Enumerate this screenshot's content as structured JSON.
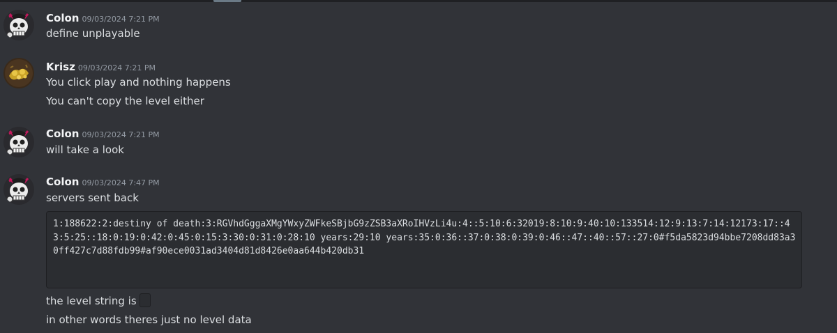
{
  "colors": {
    "background": "#313338",
    "username": "#f2f3f5",
    "timestamp": "#949ba4",
    "message_text": "#dbdee1",
    "code_background": "#2b2d31"
  },
  "messages": [
    {
      "author": "Colon",
      "avatar_icon": "skull-avatar-icon",
      "timestamp": "09/03/2024 7:21 PM",
      "lines": [
        "define unplayable"
      ]
    },
    {
      "author": "Krisz",
      "avatar_icon": "gold-coins-avatar-icon",
      "timestamp": "09/03/2024 7:21 PM",
      "lines": [
        "You click play and nothing happens",
        "You can't copy the level either"
      ]
    },
    {
      "author": "Colon",
      "avatar_icon": "skull-avatar-icon",
      "timestamp": "09/03/2024 7:21 PM",
      "lines": [
        "will take a look"
      ]
    },
    {
      "author": "Colon",
      "avatar_icon": "skull-avatar-icon",
      "timestamp": "09/03/2024 7:47 PM",
      "lines": [
        "servers sent back"
      ],
      "code_block": "1:188622:2:destiny of death:3:RGVhdGggaXMgYWxyZWFkeSBjbG9zZSB3aXRoIHVzLi4u:4::5:10:6:32019:8:10:9:40:10:133514:12:9:13:7:14:12173:17::43:5:25::18:0:19:0:42:0:45:0:15:3:30:0:31:0:28:10 years:29:10 years:35:0:36::37:0:38:0:39:0:46::47::40::57::27:0#f5da5823d94bbe7208dd83a30ff427c7d88fdb99#af90ece0031ad3404d81d8426e0aa644b420db31",
      "after_lines": [
        "the level string is",
        "in other words theres just no level data"
      ],
      "inline_code": ""
    }
  ]
}
